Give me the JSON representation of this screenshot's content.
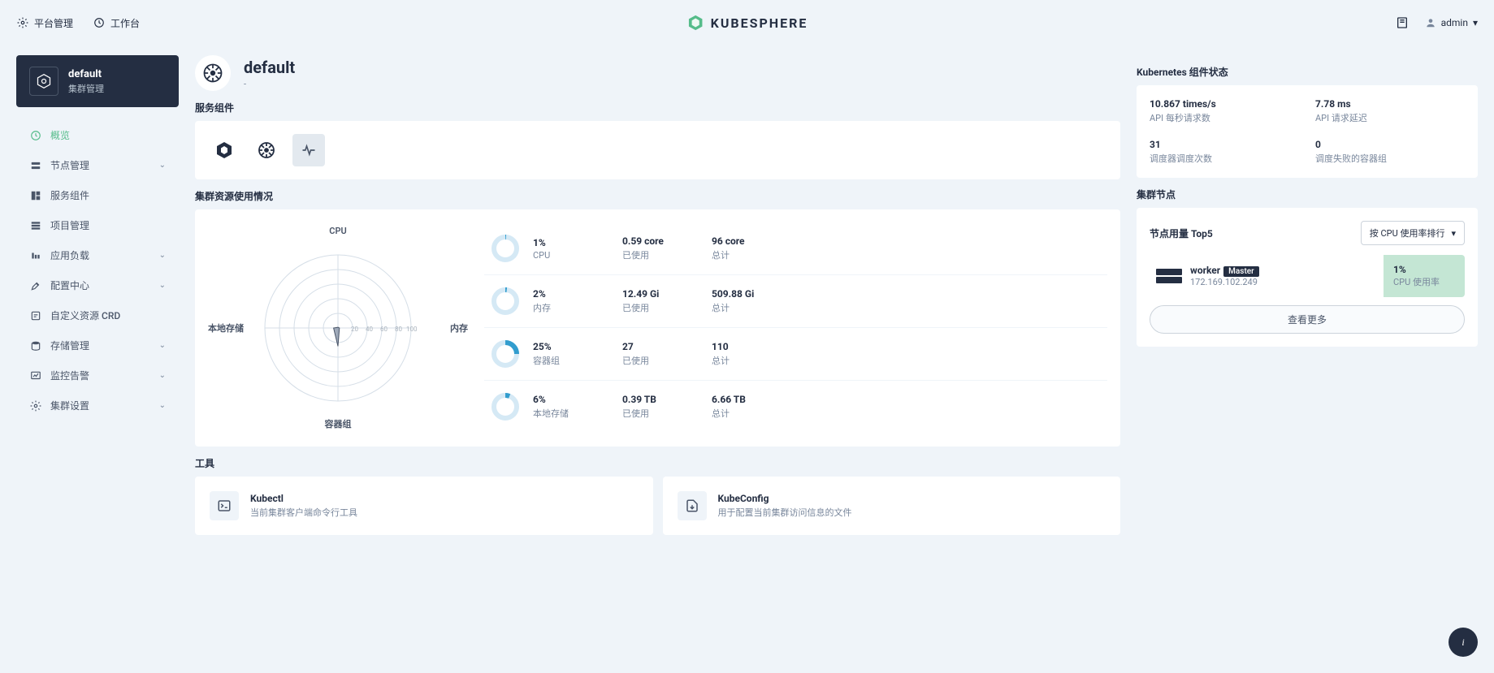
{
  "header": {
    "platform": "平台管理",
    "workbench": "工作台",
    "brand": "KUBESPHERE",
    "user": "admin"
  },
  "sidebar": {
    "title": "default",
    "subtitle": "集群管理",
    "items": [
      {
        "label": "概览",
        "active": true,
        "expandable": false,
        "icon": "overview"
      },
      {
        "label": "节点管理",
        "active": false,
        "expandable": true,
        "icon": "node"
      },
      {
        "label": "服务组件",
        "active": false,
        "expandable": false,
        "icon": "components"
      },
      {
        "label": "项目管理",
        "active": false,
        "expandable": false,
        "icon": "project"
      },
      {
        "label": "应用负载",
        "active": false,
        "expandable": true,
        "icon": "workload"
      },
      {
        "label": "配置中心",
        "active": false,
        "expandable": true,
        "icon": "config"
      },
      {
        "label": "自定义资源 CRD",
        "active": false,
        "expandable": false,
        "icon": "crd"
      },
      {
        "label": "存储管理",
        "active": false,
        "expandable": true,
        "icon": "storage"
      },
      {
        "label": "监控告警",
        "active": false,
        "expandable": true,
        "icon": "monitor"
      },
      {
        "label": "集群设置",
        "active": false,
        "expandable": true,
        "icon": "settings"
      }
    ]
  },
  "page": {
    "title": "default",
    "subtitle": "-"
  },
  "sections": {
    "components": "服务组件",
    "usage": "集群资源使用情况",
    "tools": "工具",
    "k8s_status": "Kubernetes 组件状态",
    "nodes": "集群节点"
  },
  "radar": {
    "axes": [
      "CPU",
      "内存",
      "容器组",
      "本地存储"
    ]
  },
  "metrics": [
    {
      "pct": "1%",
      "pct_num": 1,
      "name": "CPU",
      "used": "0.59 core",
      "used_lbl": "已使用",
      "total": "96 core",
      "total_lbl": "总计"
    },
    {
      "pct": "2%",
      "pct_num": 2,
      "name": "内存",
      "used": "12.49 Gi",
      "used_lbl": "已使用",
      "total": "509.88 Gi",
      "total_lbl": "总计"
    },
    {
      "pct": "25%",
      "pct_num": 25,
      "name": "容器组",
      "used": "27",
      "used_lbl": "已使用",
      "total": "110",
      "total_lbl": "总计"
    },
    {
      "pct": "6%",
      "pct_num": 6,
      "name": "本地存储",
      "used": "0.39 TB",
      "used_lbl": "已使用",
      "total": "6.66 TB",
      "total_lbl": "总计"
    }
  ],
  "tools": [
    {
      "title": "Kubectl",
      "desc": "当前集群客户端命令行工具",
      "icon": "terminal"
    },
    {
      "title": "KubeConfig",
      "desc": "用于配置当前集群访问信息的文件",
      "icon": "download"
    }
  ],
  "k8s": [
    {
      "val": "10.867 times/s",
      "lbl": "API 每秒请求数"
    },
    {
      "val": "7.78 ms",
      "lbl": "API 请求延迟"
    },
    {
      "val": "31",
      "lbl": "调度器调度次数"
    },
    {
      "val": "0",
      "lbl": "调度失败的容器组"
    }
  ],
  "nodes": {
    "top5_label": "节点用量 Top5",
    "sort_label": "按 CPU 使用率排行",
    "list": [
      {
        "name": "worker",
        "master": "Master",
        "ip": "172.169.102.249",
        "pct": "1%",
        "pct_lbl": "CPU 使用率"
      }
    ],
    "view_more": "查看更多"
  },
  "chart_data": {
    "type": "radar",
    "axes": [
      "CPU",
      "内存",
      "容器组",
      "本地存储"
    ],
    "values_pct": [
      1,
      2,
      25,
      6
    ],
    "max": 100,
    "grid_rings": [
      20,
      40,
      60,
      80,
      100
    ]
  }
}
